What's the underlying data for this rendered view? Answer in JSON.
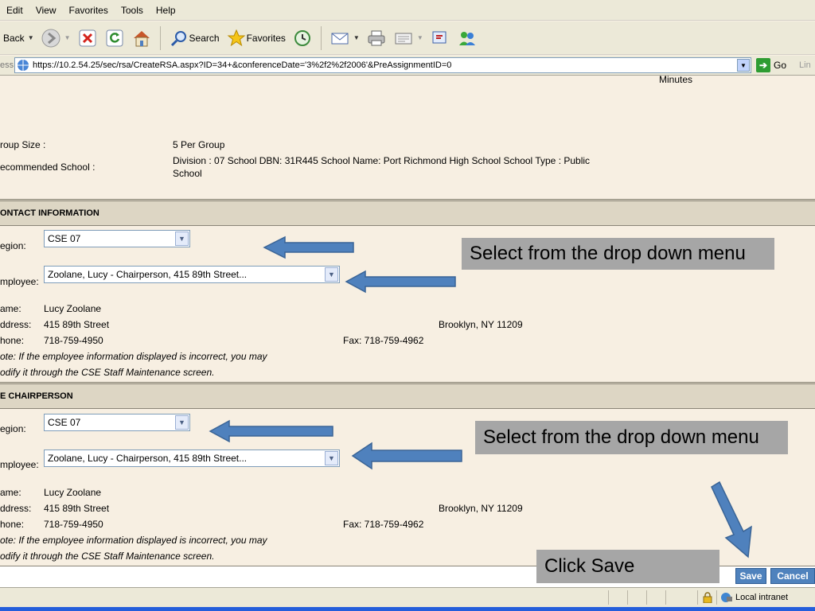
{
  "menubar": {
    "items": [
      "Edit",
      "View",
      "Favorites",
      "Tools",
      "Help"
    ]
  },
  "toolbar": {
    "back_label": "Back",
    "search_label": "Search",
    "favorites_label": "Favorites"
  },
  "addressbar": {
    "label": "ess",
    "url": "https://10.2.54.25/sec/rsa/CreateRSA.aspx?ID=34+&conferenceDate='3%2f2%2f2006'&PreAssignmentID=0",
    "go_label": "Go",
    "links_label": "Lin"
  },
  "page": {
    "minutes_label": "Minutes",
    "group_size_label": "roup Size :",
    "group_size_value": "5  Per Group",
    "recommended_school_label": "ecommended School :",
    "recommended_school_line1": "Division : 07  School DBN: 31R445  School Name: Port Richmond High School  School Type : Public",
    "recommended_school_line2": "School"
  },
  "contact": {
    "header": "ONTACT INFORMATION",
    "region_label": "egion:",
    "region_value": "CSE 07",
    "employee_label": "mployee:",
    "employee_value": "Zoolane, Lucy - Chairperson, 415 89th Street...",
    "name_label": "ame:",
    "name_value": "Lucy Zoolane",
    "address_label": "ddress:",
    "address_value": "415 89th Street",
    "city_value": "Brooklyn, NY 11209",
    "phone_label": "hone:",
    "phone_value": "718-759-4950",
    "fax_value": "Fax: 718-759-4962",
    "note_line1": "ote: If the employee information displayed is incorrect, you may",
    "note_line2": "odify it through the CSE Staff Maintenance screen."
  },
  "chairperson": {
    "header": "E CHAIRPERSON",
    "region_label": "egion:",
    "region_value": "CSE 07",
    "employee_label": "mployee:",
    "employee_value": "Zoolane, Lucy - Chairperson, 415 89th Street...",
    "name_label": "ame:",
    "name_value": "Lucy Zoolane",
    "address_label": "ddress:",
    "address_value": "415 89th Street",
    "city_value": "Brooklyn, NY 11209",
    "phone_label": "hone:",
    "phone_value": "718-759-4950",
    "fax_value": "Fax: 718-759-4962",
    "note_line1": "ote: If the employee information displayed is incorrect, you may",
    "note_line2": "odify it through the CSE Staff Maintenance screen."
  },
  "callouts": {
    "contact": "Select from the drop down menu",
    "chairperson": "Select from the drop down menu",
    "save": "Click Save"
  },
  "actions": {
    "save_label": "Save",
    "cancel_label": "Cancel"
  },
  "statusbar": {
    "zone_label": "Local intranet"
  },
  "colors": {
    "page_background": "#f7efe2",
    "section_header": "#ddd6c4",
    "callout_background": "#a6a6a6",
    "arrow_fill": "#4f81bd",
    "button_background": "#4f82bd"
  }
}
